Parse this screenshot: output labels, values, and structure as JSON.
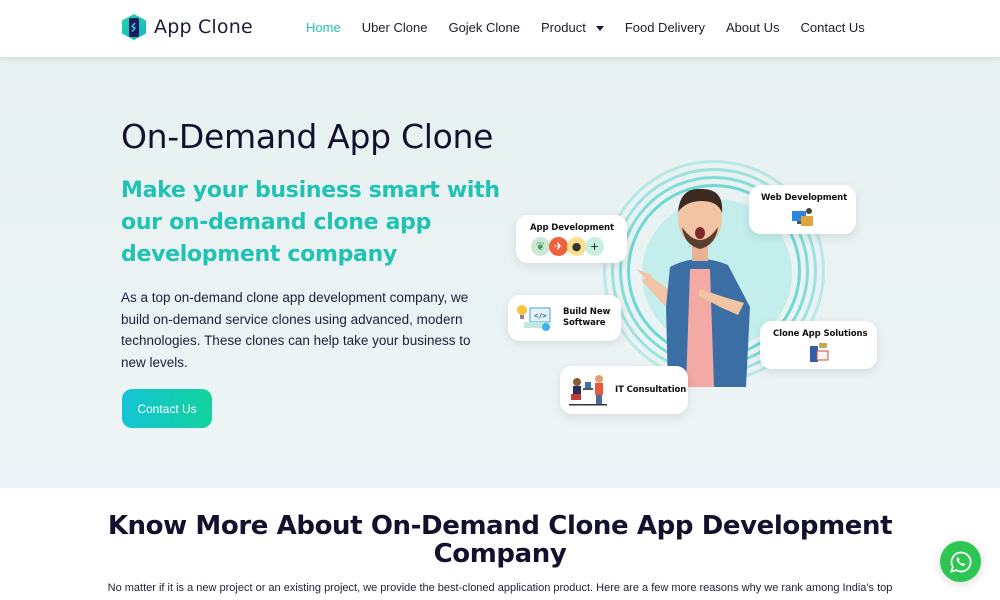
{
  "header": {
    "logo_text": "App Clone",
    "nav": [
      {
        "label": "Home",
        "active": true
      },
      {
        "label": "Uber Clone"
      },
      {
        "label": "Gojek Clone"
      },
      {
        "label": "Product",
        "has_dropdown": true
      },
      {
        "label": "Food Delivery"
      },
      {
        "label": "About Us"
      },
      {
        "label": "Contact Us"
      }
    ]
  },
  "hero": {
    "title": "On-Demand App Clone",
    "subtitle": "Make your business smart with our on-demand clone app development company",
    "description": "As a top on-demand clone app development company, we build on-demand service clones using advanced, modern technologies. These clones can help take your business to new levels.",
    "cta_label": "Contact Us",
    "cards": {
      "app_development": "App Development",
      "web_development": "Web Development",
      "build_software": "Build New Software",
      "clone_solutions": "Clone App Solutions",
      "it_consultation": "IT Consultation"
    }
  },
  "about": {
    "title": "Know More About On-Demand Clone App Development Company",
    "text": "No matter if it is a new project or an existing project, we provide the best-cloned application product. Here are a few more reasons why we rank among India's top"
  },
  "colors": {
    "accent": "#1cc5b7",
    "button_gradient_start": "#14c4d6",
    "button_gradient_end": "#13d39c",
    "whatsapp": "#2dc653",
    "hero_bg": "#e9f2f1"
  }
}
